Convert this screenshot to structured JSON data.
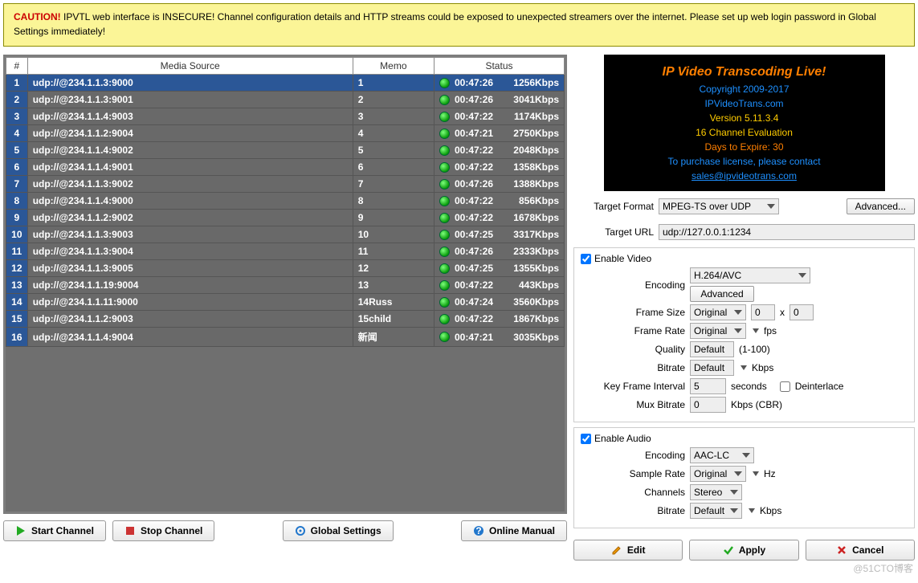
{
  "warning": {
    "caution": "CAUTION!",
    "text": " IPVTL web interface is INSECURE! Channel configuration details and HTTP streams could be exposed to unexpected streamers over the internet. Please set up web login password in Global Settings immediately!"
  },
  "grid": {
    "headers": {
      "num": "#",
      "source": "Media Source",
      "memo": "Memo",
      "status": "Status"
    },
    "rows": [
      {
        "n": "1",
        "src": "udp://@234.1.1.3:9000",
        "memo": "1",
        "time": "00:47:26",
        "rate": "1256Kbps",
        "selected": true
      },
      {
        "n": "2",
        "src": "udp://@234.1.1.3:9001",
        "memo": "2",
        "time": "00:47:26",
        "rate": "3041Kbps"
      },
      {
        "n": "3",
        "src": "udp://@234.1.1.4:9003",
        "memo": "3",
        "time": "00:47:22",
        "rate": "1174Kbps"
      },
      {
        "n": "4",
        "src": "udp://@234.1.1.2:9004",
        "memo": "4",
        "time": "00:47:21",
        "rate": "2750Kbps"
      },
      {
        "n": "5",
        "src": "udp://@234.1.1.4:9002",
        "memo": "5",
        "time": "00:47:22",
        "rate": "2048Kbps"
      },
      {
        "n": "6",
        "src": "udp://@234.1.1.4:9001",
        "memo": "6",
        "time": "00:47:22",
        "rate": "1358Kbps"
      },
      {
        "n": "7",
        "src": "udp://@234.1.1.3:9002",
        "memo": "7",
        "time": "00:47:26",
        "rate": "1388Kbps"
      },
      {
        "n": "8",
        "src": "udp://@234.1.1.4:9000",
        "memo": "8",
        "time": "00:47:22",
        "rate": "856Kbps"
      },
      {
        "n": "9",
        "src": "udp://@234.1.1.2:9002",
        "memo": "9",
        "time": "00:47:22",
        "rate": "1678Kbps"
      },
      {
        "n": "10",
        "src": "udp://@234.1.1.3:9003",
        "memo": "10",
        "time": "00:47:25",
        "rate": "3317Kbps"
      },
      {
        "n": "11",
        "src": "udp://@234.1.1.3:9004",
        "memo": "11",
        "time": "00:47:26",
        "rate": "2333Kbps"
      },
      {
        "n": "12",
        "src": "udp://@234.1.1.3:9005",
        "memo": "12",
        "time": "00:47:25",
        "rate": "1355Kbps"
      },
      {
        "n": "13",
        "src": "udp://@234.1.1.19:9004",
        "memo": "13",
        "time": "00:47:22",
        "rate": "443Kbps"
      },
      {
        "n": "14",
        "src": "udp://@234.1.1.11:9000",
        "memo": "14Russ",
        "time": "00:47:24",
        "rate": "3560Kbps"
      },
      {
        "n": "15",
        "src": "udp://@234.1.1.2:9003",
        "memo": "15child",
        "time": "00:47:22",
        "rate": "1867Kbps"
      },
      {
        "n": "16",
        "src": "udp://@234.1.1.4:9004",
        "memo": "新闻",
        "time": "00:47:21",
        "rate": "3035Kbps"
      }
    ]
  },
  "actions": {
    "start": "Start Channel",
    "stop": "Stop Channel",
    "global": "Global Settings",
    "manual": "Online Manual"
  },
  "info": {
    "title": "IP Video Transcoding Live!",
    "copyright": "Copyright 2009-2017",
    "site": "IPVideoTrans.com",
    "version": "Version 5.11.3.4",
    "eval": "16 Channel Evaluation",
    "expire": "Days to Expire: 30",
    "contact": "To purchase license, please contact",
    "email": "sales@ipvideotrans.com"
  },
  "config": {
    "target_format_label": "Target Format",
    "target_format_value": "MPEG-TS over UDP",
    "advanced_btn": "Advanced...",
    "target_url_label": "Target URL",
    "target_url_value": "udp://127.0.0.1:1234",
    "enable_video": "Enable Video",
    "enable_audio": "Enable Audio",
    "video": {
      "encoding_label": "Encoding",
      "encoding_value": "H.264/AVC",
      "advanced": "Advanced",
      "fsize_label": "Frame Size",
      "fsize_value": "Original",
      "w": "0",
      "x": "x",
      "h": "0",
      "frate_label": "Frame Rate",
      "frate_value": "Original",
      "frate_unit": "fps",
      "quality_label": "Quality",
      "quality_value": "Default",
      "quality_unit": "(1-100)",
      "bitrate_label": "Bitrate",
      "bitrate_value": "Default",
      "bitrate_unit": "Kbps",
      "keyframe_label": "Key Frame Interval",
      "keyframe_value": "5",
      "keyframe_unit": "seconds",
      "deinterlace": "Deinterlace",
      "mux_label": "Mux Bitrate",
      "mux_value": "0",
      "mux_unit": "Kbps (CBR)"
    },
    "audio": {
      "encoding_label": "Encoding",
      "encoding_value": "AAC-LC",
      "srate_label": "Sample Rate",
      "srate_value": "Original",
      "srate_unit": "Hz",
      "channels_label": "Channels",
      "channels_value": "Stereo",
      "bitrate_label": "Bitrate",
      "bitrate_value": "Default",
      "bitrate_unit": "Kbps"
    }
  },
  "right_actions": {
    "edit": "Edit",
    "apply": "Apply",
    "cancel": "Cancel"
  },
  "watermark": "@51CTO博客"
}
